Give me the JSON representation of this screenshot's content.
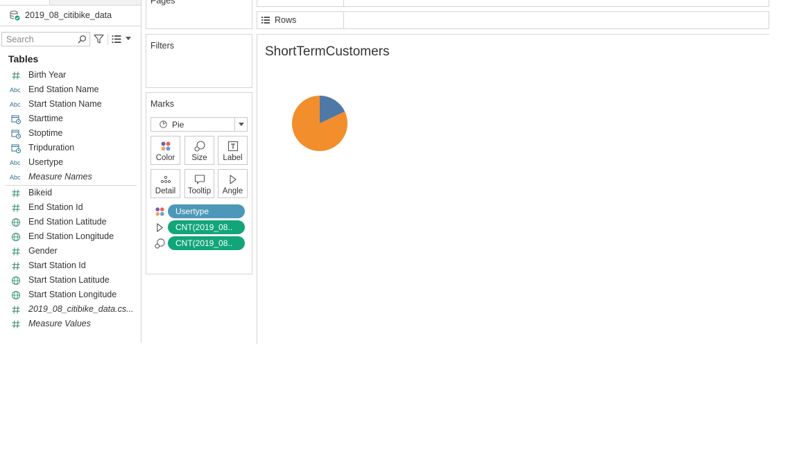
{
  "data_pane": {
    "data_source": "2019_08_citibike_data",
    "search_placeholder": "Search",
    "tables_heading": "Tables",
    "dimensions": [
      {
        "type": "number",
        "name": "Birth Year"
      },
      {
        "type": "string",
        "name": "End Station Name"
      },
      {
        "type": "string",
        "name": "Start Station Name"
      },
      {
        "type": "datetime",
        "name": "Starttime"
      },
      {
        "type": "datetime",
        "name": "Stoptime"
      },
      {
        "type": "datetime",
        "name": "Tripduration"
      },
      {
        "type": "string",
        "name": "Usertype"
      },
      {
        "type": "string",
        "name": "Measure Names",
        "italic": true
      }
    ],
    "measures": [
      {
        "type": "number",
        "name": "Bikeid"
      },
      {
        "type": "number",
        "name": "End Station Id"
      },
      {
        "type": "geo",
        "name": "End Station Latitude"
      },
      {
        "type": "geo",
        "name": "End Station Longitude"
      },
      {
        "type": "number",
        "name": "Gender"
      },
      {
        "type": "number",
        "name": "Start Station Id"
      },
      {
        "type": "geo",
        "name": "Start Station Latitude"
      },
      {
        "type": "geo",
        "name": "Start Station Longitude"
      },
      {
        "type": "number",
        "name": "2019_08_citibike_data.cs...",
        "italic": true
      },
      {
        "type": "number",
        "name": "Measure Values",
        "italic": true
      }
    ]
  },
  "type_glyph_text": {
    "string": "Abc"
  },
  "pages_title": "Pages",
  "filters_title": "Filters",
  "marks": {
    "title": "Marks",
    "mark_type": "Pie",
    "buttons": [
      {
        "icon": "color-icon",
        "label": "Color"
      },
      {
        "icon": "size-icon",
        "label": "Size"
      },
      {
        "icon": "label-icon",
        "label": "Label"
      },
      {
        "icon": "detail-icon",
        "label": "Detail"
      },
      {
        "icon": "tooltip-icon",
        "label": "Tooltip"
      },
      {
        "icon": "angle-icon",
        "label": "Angle"
      }
    ],
    "pills": [
      {
        "encoding": "color",
        "label": "Usertype",
        "kind": "dimension"
      },
      {
        "encoding": "angle",
        "label": "CNT(2019_08..",
        "kind": "measure"
      },
      {
        "encoding": "size",
        "label": "CNT(2019_08..",
        "kind": "measure"
      }
    ]
  },
  "rows_label": "Rows",
  "sheet_title": "ShortTermCustomers",
  "colors": {
    "series_blue": "#4e79a7",
    "series_orange": "#f28e2b",
    "dimension_pill": "#4d97b8",
    "measure_pill": "#12a57a",
    "field_icon": "#3a8f7a"
  },
  "chart_data": {
    "type": "pie",
    "slices": [
      {
        "share": 0.18,
        "color": "#4e79a7"
      },
      {
        "share": 0.82,
        "color": "#f28e2b"
      }
    ]
  }
}
